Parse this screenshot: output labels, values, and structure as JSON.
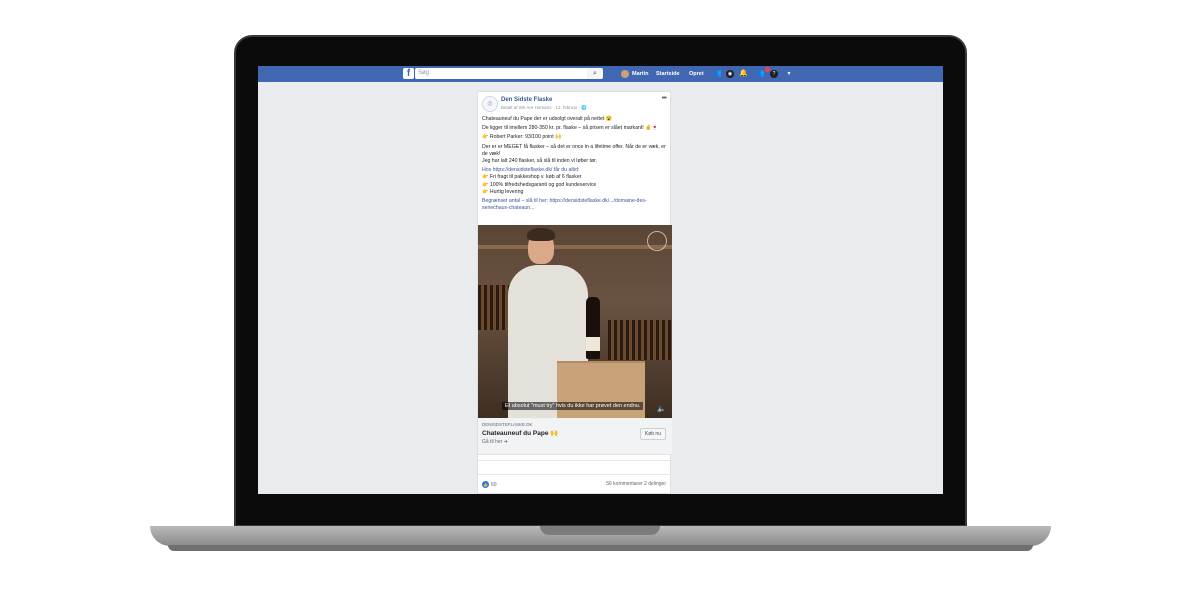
{
  "topbar": {
    "logo": "f",
    "search_placeholder": "Søg",
    "user_name": "Martin",
    "home_label": "Startside",
    "create_label": "Opret",
    "icons": [
      "friends-icon",
      "messenger-icon",
      "notifications-icon",
      "quick-help-icon",
      "help-icon",
      "dropdown-icon"
    ]
  },
  "post": {
    "page_name": "Den Sidste Flaske",
    "meta": "Betalt af We Are Humans · 13. februar ·",
    "lines": [
      "Chateauneuf du Pape der er udsolgt overalt på nettet 😮",
      "De ligger til imellem 280-350 kr. pr. flaske – så prisen er slået markant! ✌️🍷",
      "👉 Robert Parker: 93/100 point 🙌",
      "Der er er MEGET få flasker – så det er once in a lifetime offer. Når de er væk, er de væk!",
      "Jeg har lalt 240 flasker, så slå til inden vi løber tør.",
      "Hos https://densidsteflaske.dk/ får du altid:",
      "👉 Fri fragt til pakkeshop v. køb af 6 flasker",
      "👉 100% tilfredshedsgaranti og god kundeservice",
      "👉 Hurtig levering",
      "Begrænset antal – slå til her: https://densidsteflaske.dk/.../domaine-des-senechaux-chateaun..."
    ],
    "video_subtitle": "Et absolut \"must try\" hvis du ikke har prøvet den endnu.",
    "link": {
      "domain": "DENSIDSTEFLASKE.DK",
      "title": "Chateauneuf du Pape 🙌",
      "subtitle": "Gå til her ➔",
      "button": "Køb nu"
    },
    "reactions_count": "60",
    "comments_shares": "56 kommentarer  2 delinger"
  }
}
